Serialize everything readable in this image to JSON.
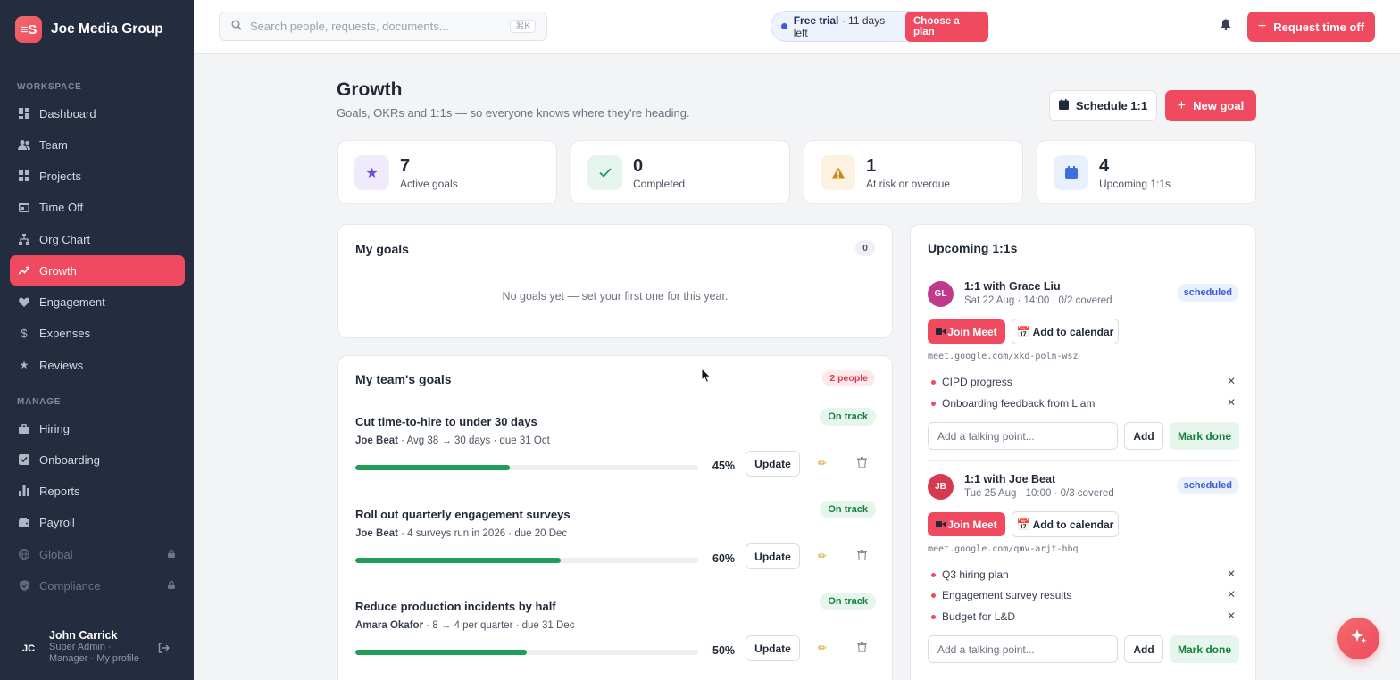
{
  "brand": {
    "logo": "≡S",
    "name": "Joe Media Group"
  },
  "sidebar": {
    "workspace_label": "WORKSPACE",
    "manage_label": "MANAGE",
    "workspace_items": [
      {
        "label": "Dashboard",
        "icon": "dashboard-icon"
      },
      {
        "label": "Team",
        "icon": "team-icon"
      },
      {
        "label": "Projects",
        "icon": "projects-icon"
      },
      {
        "label": "Time Off",
        "icon": "calendar-icon"
      },
      {
        "label": "Org Chart",
        "icon": "org-chart-icon"
      },
      {
        "label": "Growth",
        "icon": "trend-icon",
        "active": true
      },
      {
        "label": "Engagement",
        "icon": "heart-icon"
      },
      {
        "label": "Expenses",
        "icon": "dollar-icon"
      },
      {
        "label": "Reviews",
        "icon": "star-icon"
      }
    ],
    "manage_items": [
      {
        "label": "Hiring",
        "icon": "briefcase-icon"
      },
      {
        "label": "Onboarding",
        "icon": "checkbox-icon"
      },
      {
        "label": "Reports",
        "icon": "bar-chart-icon"
      },
      {
        "label": "Payroll",
        "icon": "wallet-icon"
      },
      {
        "label": "Global",
        "icon": "globe-icon",
        "locked": true
      },
      {
        "label": "Compliance",
        "icon": "shield-icon",
        "locked": true
      }
    ],
    "user": {
      "initials": "JC",
      "name": "John Carrick",
      "role": "Super Admin ·",
      "links": "Manager · My profile"
    }
  },
  "topbar": {
    "search_placeholder": "Search people, requests, documents...",
    "search_shortcut": "⌘K",
    "trial_label": "Free trial",
    "trial_days": " · 11 days left",
    "plan_button": "Choose a plan",
    "request_button": "Request time off"
  },
  "page": {
    "title": "Growth",
    "subtitle": "Goals, OKRs and 1:1s — so everyone knows where they're heading.",
    "schedule_button": "Schedule 1:1",
    "new_goal_button": "New goal"
  },
  "stats": [
    {
      "value": "7",
      "label": "Active goals",
      "icon": "star-icon",
      "bg": "#efeafc",
      "fg": "#6d4ed8"
    },
    {
      "value": "0",
      "label": "Completed",
      "icon": "check-icon",
      "bg": "#e6f6ec",
      "fg": "#1e9e5a"
    },
    {
      "value": "1",
      "label": "At risk or overdue",
      "icon": "warning-icon",
      "bg": "#fdf1e1",
      "fg": "#b7791f"
    },
    {
      "value": "4",
      "label": "Upcoming 1:1s",
      "icon": "calendar-icon",
      "bg": "#e8effd",
      "fg": "#3b6fe0"
    }
  ],
  "my_goals": {
    "title": "My goals",
    "count": "0",
    "empty_text": "No goals yet — set your first one for this year."
  },
  "team_goals": {
    "title": "My team's goals",
    "count": "2 people",
    "update_label": "Update",
    "items": [
      {
        "title": "Cut time-to-hire to under 30 days",
        "status": "On track",
        "owner": "Joe Beat",
        "detail": " · Avg 38 → 30 days · due 31 Oct",
        "progress": 45,
        "progress_label": "45%"
      },
      {
        "title": "Roll out quarterly engagement surveys",
        "status": "On track",
        "owner": "Joe Beat",
        "detail": " · 4 surveys run in 2026 · due 20 Dec",
        "progress": 60,
        "progress_label": "60%"
      },
      {
        "title": "Reduce production incidents by half",
        "status": "On track",
        "owner": "Amara Okafor",
        "detail": " · 8 → 4 per quarter · due 31 Dec",
        "progress": 50,
        "progress_label": "50%"
      }
    ]
  },
  "one_on_ones": {
    "title": "Upcoming 1:1s",
    "join_label": "Join Meet",
    "calendar_label": "Add to calendar",
    "input_placeholder": "Add a talking point...",
    "add_label": "Add",
    "done_label": "Mark done",
    "items": [
      {
        "initials": "GL",
        "avatar_color": "#c0398a",
        "title": "1:1 with Grace Liu",
        "meta": "Sat 22 Aug · 14:00 · 0/2 covered",
        "status": "scheduled",
        "link": "meet.google.com/xkd-poln-wsz",
        "points": [
          "CIPD progress",
          "Onboarding feedback from Liam"
        ]
      },
      {
        "initials": "JB",
        "avatar_color": "#d63a4f",
        "title": "1:1 with Joe Beat",
        "meta": "Tue 25 Aug · 10:00 · 0/3 covered",
        "status": "scheduled",
        "link": "meet.google.com/qmv-arjt-hbq",
        "points": [
          "Q3 hiring plan",
          "Engagement survey results",
          "Budget for L&D"
        ]
      }
    ]
  },
  "colors": {
    "accent": "#ef4a5f",
    "sidebar_bg": "#232d3f",
    "success": "#1e9e5a",
    "info": "#3b5bdb"
  }
}
